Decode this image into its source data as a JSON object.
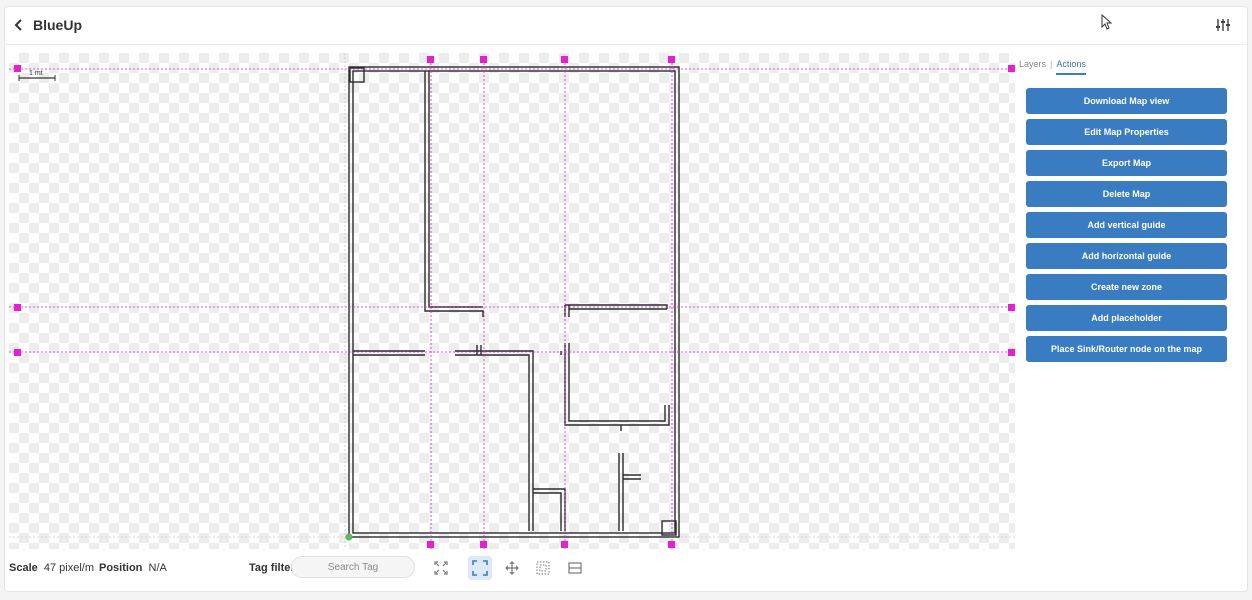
{
  "header": {
    "title": "BlueUp",
    "back_icon": "chevron-left-icon",
    "settings_icon": "sliders-icon"
  },
  "map": {
    "scale_label": "1 mt"
  },
  "side": {
    "tabs": [
      "Layers",
      "Actions"
    ],
    "active_tab": "Actions",
    "actions": [
      "Download Map view",
      "Edit Map Properties",
      "Export Map",
      "Delete Map",
      "Add vertical guide",
      "Add horizontal guide",
      "Create new zone",
      "Add placeholder",
      "Place Sink/Router node on the map"
    ]
  },
  "footer": {
    "scale_label": "Scale",
    "scale_value": "47 pixel/m",
    "position_label": "Position",
    "position_value": "N/A",
    "tag_filter_label": "Tag filter",
    "search_placeholder": "Search Tag",
    "tools": [
      "fit-screen-icon",
      "frame-select-icon",
      "move-icon",
      "grid-select-icon",
      "horizontal-guide-icon"
    ]
  },
  "colors": {
    "accent": "#3a7cc1",
    "guide": "#e81fd0",
    "wall": "#2b2b2b"
  }
}
